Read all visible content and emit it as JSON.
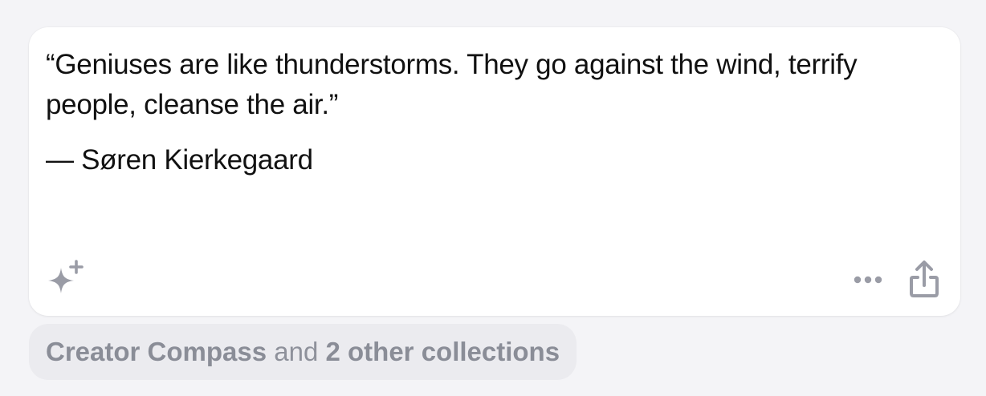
{
  "card": {
    "quote": "“Geniuses are like thunderstorms. They go against the wind, terrify people, cleanse the air.”",
    "author": "— Søren Kierkegaard"
  },
  "actions": {
    "sparkle_icon": "sparkles-icon",
    "more_icon": "ellipsis-icon",
    "share_icon": "share-icon"
  },
  "collections": {
    "primary": "Creator Compass",
    "connector": " and ",
    "others": "2 other collections"
  },
  "colors": {
    "background": "#f4f4f7",
    "card": "#ffffff",
    "icon": "#9a9ca6",
    "pill": "#ebebef",
    "pill_text": "#8e919b"
  }
}
